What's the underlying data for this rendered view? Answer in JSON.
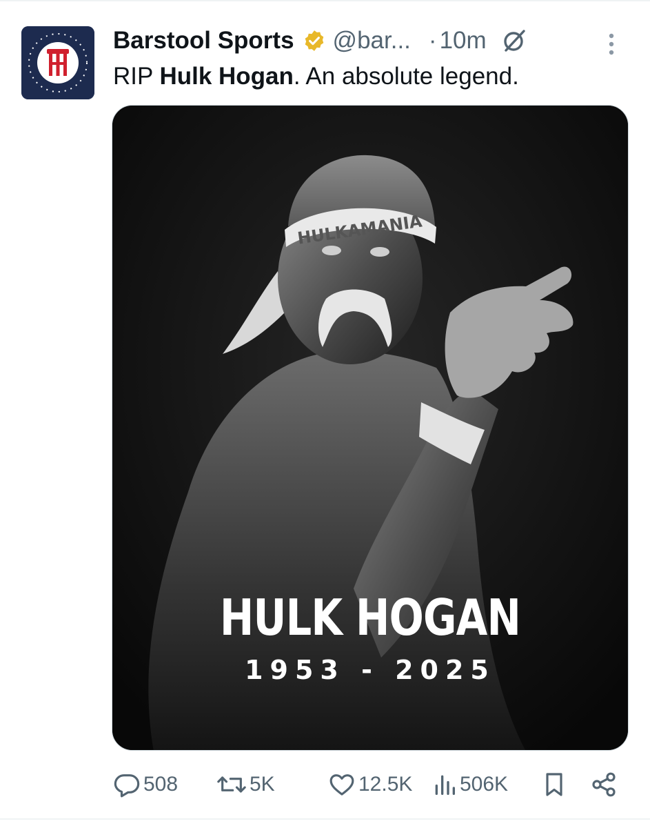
{
  "post": {
    "display_name": "Barstool Sports",
    "handle": "@bar...",
    "separator": "·",
    "time": "10m",
    "text_prefix": "RIP ",
    "text_bold": "Hulk Hogan",
    "text_suffix": ". An absolute legend."
  },
  "media": {
    "title": "HULK HOGAN",
    "years": "1953 - 2025",
    "headband_text": "HULKAMANIA"
  },
  "actions": {
    "replies": "508",
    "reposts": "5K",
    "likes": "12.5K",
    "views": "506K"
  },
  "icons": {
    "avatar": "barstool-logo",
    "verified": "verified-badge-icon",
    "grok": "grok-icon",
    "more": "more-vertical-icon",
    "reply": "reply-icon",
    "repost": "repost-icon",
    "like": "heart-icon",
    "views": "views-icon",
    "bookmark": "bookmark-icon",
    "share": "share-icon"
  },
  "colors": {
    "text_primary": "#0f1419",
    "text_secondary": "#536471",
    "verified_gold": "#e8b829",
    "logo_navy": "#1d2b4f",
    "logo_red": "#d0202e"
  }
}
